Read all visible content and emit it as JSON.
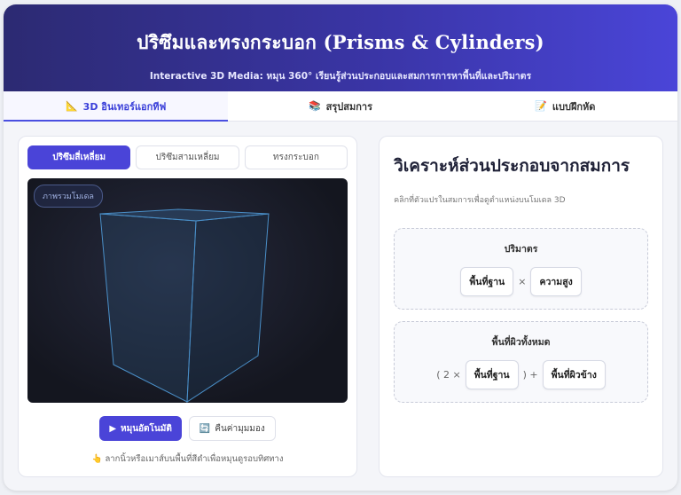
{
  "header": {
    "title": "ปริซึมและทรงกระบอก (Prisms & Cylinders)",
    "subtitle": "Interactive 3D Media: หมุน 360° เรียนรู้ส่วนประกอบและสมการการหาพื้นที่และปริมาตร"
  },
  "tabs": [
    {
      "icon": "📐",
      "label": "3D อินเทอร์แอกทีฟ",
      "active": true
    },
    {
      "icon": "📚",
      "label": "สรุปสมการ",
      "active": false
    },
    {
      "icon": "📝",
      "label": "แบบฝึกหัด",
      "active": false
    }
  ],
  "shapes": [
    "ปริซึมสี่เหลี่ยม",
    "ปริซึมสามเหลี่ยม",
    "ทรงกระบอก"
  ],
  "viewport": {
    "badge": "ภาพรวมโมเดล"
  },
  "controls": {
    "rotate_icon": "▶",
    "rotate_label": "หมุนอัตโนมัติ",
    "reset_icon": "🔄",
    "reset_label": "คืนค่ามุมมอง"
  },
  "hint": {
    "icon": "👆",
    "text": "ลากนิ้วหรือเมาส์บนพื้นที่สีดำเพื่อหมุนดูรอบทิศทาง"
  },
  "analysis": {
    "title": "วิเคราะห์ส่วนประกอบจากสมการ",
    "desc": "คลิกที่ตัวแปรในสมการเพื่อดูตำแหน่งบนโมเดล 3D",
    "volume": {
      "title": "ปริมาตร",
      "term1": "พื้นที่ฐาน",
      "op": "×",
      "term2": "ความสูง"
    },
    "surface": {
      "title": "พื้นที่ผิวทั้งหมด",
      "prefix": "( 2 ×",
      "term1": "พื้นที่ฐาน",
      "suffix": ") +",
      "term2": "พื้นที่ผิวข้าง"
    }
  },
  "colors": {
    "accent": "#4a44d8",
    "header_start": "#2c2a72",
    "header_end": "#4a45d8",
    "wireframe": "#4a8fc8"
  }
}
